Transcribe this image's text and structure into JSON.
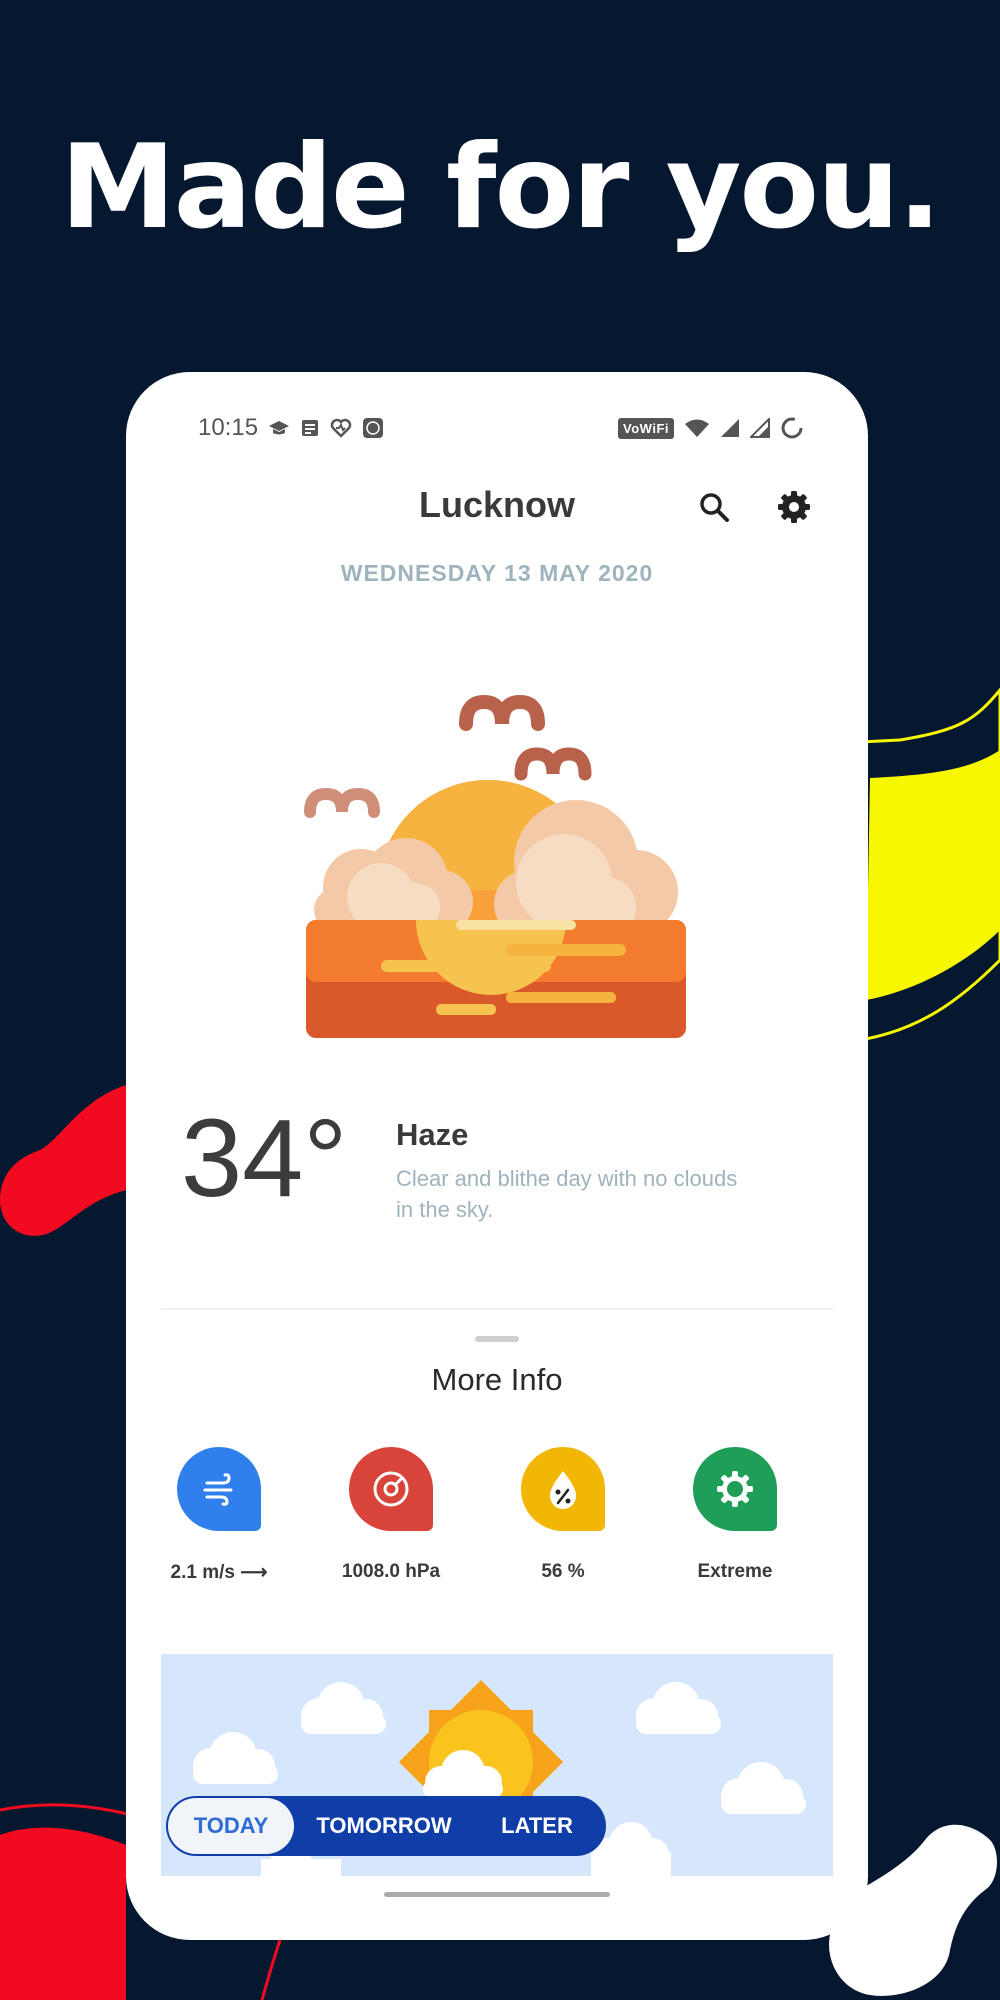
{
  "headline": "Made for you.",
  "status_bar": {
    "time": "10:15",
    "wifi_badge": "VoWiFi",
    "icons": [
      "graduation-cap-icon",
      "document-icon",
      "heart-rate-icon",
      "app-icon",
      "wifi-icon",
      "signal-icon",
      "signal-icon",
      "battery-icon"
    ]
  },
  "app": {
    "title": "Lucknow",
    "date": "WEDNESDAY  13  MAY  2020",
    "temperature": "34°",
    "condition": "Haze",
    "description": "Clear and blithe day with no clouds in the sky."
  },
  "more_info": {
    "title": "More Info",
    "stats": [
      {
        "value": "2.1 m/s ⟶",
        "icon": "wind-icon",
        "color": "#2f80ed"
      },
      {
        "value": "1008.0 hPa",
        "icon": "pressure-gauge-icon",
        "color": "#d9443a"
      },
      {
        "value": "56 %",
        "icon": "humidity-drop-icon",
        "color": "#f2b705"
      },
      {
        "value": "Extreme",
        "icon": "uv-sun-icon",
        "color": "#1e9e57"
      }
    ]
  },
  "tabs": [
    "TODAY",
    "TOMORROW",
    "LATER"
  ],
  "colors": {
    "background": "#06182f",
    "accent_yellow": "#f7f700",
    "accent_red": "#f20a20",
    "tab_bar": "#0f3ea8"
  }
}
